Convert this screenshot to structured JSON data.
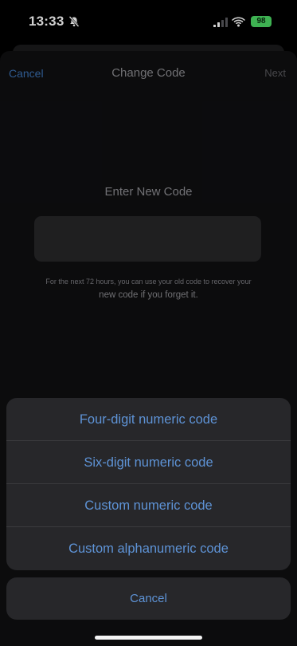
{
  "status_bar": {
    "time": "13:33",
    "battery": "98",
    "icons": [
      "bell-slash-icon",
      "signal-icon",
      "wifi-icon",
      "battery-icon"
    ],
    "battery_color": "#4cd964"
  },
  "nav": {
    "cancel_label": "Cancel",
    "title": "Change Code",
    "next_label": "Next"
  },
  "main": {
    "prompt": "Enter New Code",
    "code_value": "",
    "hint_line1": "For the next 72 hours, you can use your old code to recover your",
    "hint_line2": "new code if you forget it."
  },
  "action_sheet": {
    "options": [
      {
        "label": "Four-digit numeric code"
      },
      {
        "label": "Six-digit numeric code"
      },
      {
        "label": "Custom numeric code"
      },
      {
        "label": "Custom alphanumeric code"
      }
    ],
    "cancel_label": "Cancel"
  },
  "colors": {
    "accent": "#5e93d6",
    "sheet_background": "#27272a"
  }
}
